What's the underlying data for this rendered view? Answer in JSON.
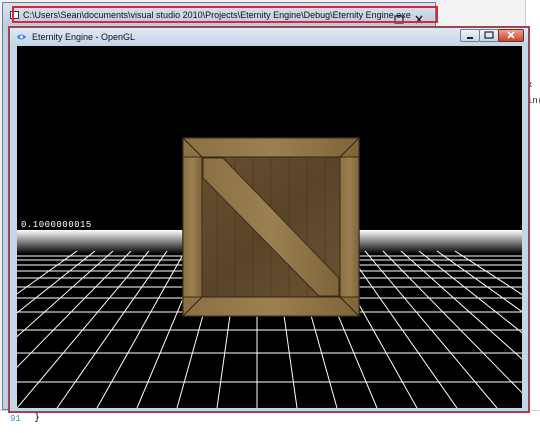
{
  "console_window": {
    "title": "C:\\Users\\Sean\\documents\\visual studio 2010\\Projects\\Eternity Engine\\Debug\\Eternity Engine.exe",
    "cursor": "_"
  },
  "gl_window": {
    "title": "Eternity Engine - OpenGL",
    "readout": "0.1000000015"
  },
  "ide": {
    "right_fragments": [
      "in(",
      "x"
    ],
    "line_number": "91",
    "code_line": "}"
  },
  "colors": {
    "highlight": "#e0262f",
    "viewport_bg": "#000000",
    "grid_line": "#ffffff"
  }
}
